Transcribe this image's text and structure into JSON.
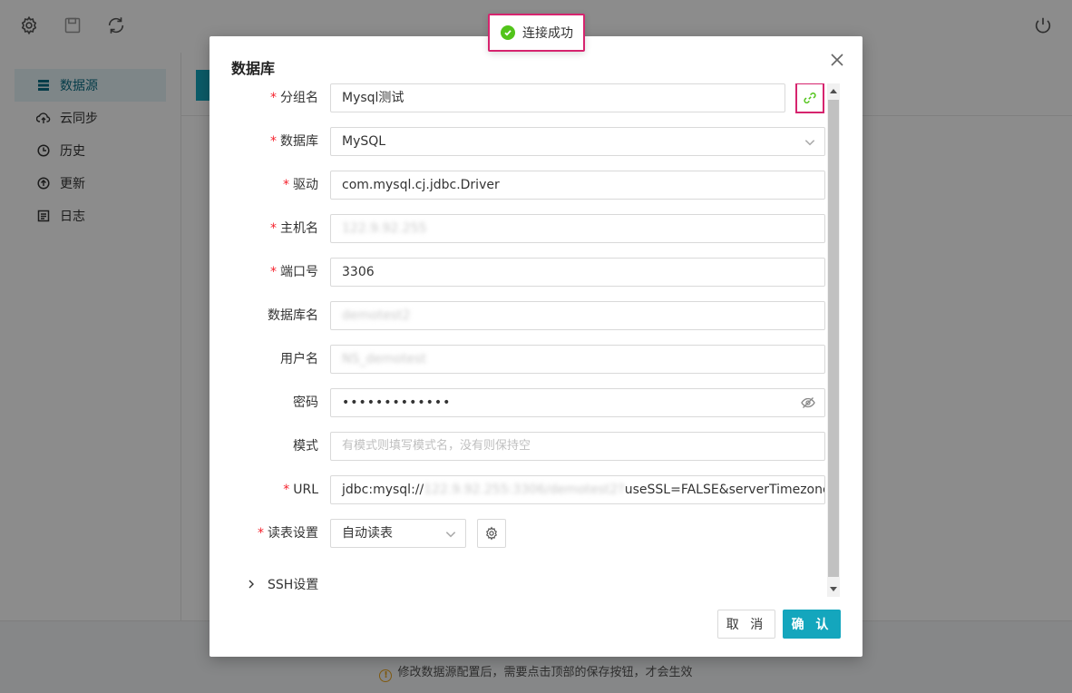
{
  "sidebar": {
    "items": [
      {
        "label": "数据源",
        "icon": "database-icon",
        "active": true
      },
      {
        "label": "云同步",
        "icon": "cloud-sync-icon"
      },
      {
        "label": "历史",
        "icon": "clock-icon"
      },
      {
        "label": "更新",
        "icon": "update-icon"
      },
      {
        "label": "日志",
        "icon": "log-icon"
      }
    ]
  },
  "footer": {
    "tip": "修改数据源配置后，需要点击顶部的保存按钮，才会生效"
  },
  "toast": {
    "message": "连接成功"
  },
  "dialog": {
    "title": "数据库",
    "fields": {
      "group_name": {
        "label": "分组名",
        "value": "Mysql测试"
      },
      "database": {
        "label": "数据库",
        "value": "MySQL"
      },
      "driver": {
        "label": "驱动",
        "value": "com.mysql.cj.jdbc.Driver"
      },
      "host": {
        "label": "主机名",
        "value": "122.9.92.255"
      },
      "port": {
        "label": "端口号",
        "value": "3306"
      },
      "db_name": {
        "label": "数据库名",
        "value": "demotest2"
      },
      "username": {
        "label": "用户名",
        "value": "NS_demotest"
      },
      "password": {
        "label": "密码",
        "value": "•••••••••••••"
      },
      "schema": {
        "label": "模式",
        "placeholder": "有模式则填写模式名，没有则保持空"
      },
      "url": {
        "label": "URL",
        "prefix": "jdbc:mysql://",
        "blurred": "122.9.92.255:3306/demotest2?",
        "suffix": "useSSL=FALSE&serverTimezone=Asia/Sha"
      },
      "read_table": {
        "label": "读表设置",
        "value": "自动读表"
      }
    },
    "ssh_label": "SSH设置",
    "cancel_label": "取 消",
    "ok_label": "确 认"
  },
  "colors": {
    "accent": "#14a6bd",
    "highlight": "#d6246e",
    "success": "#52c41a",
    "required": "#f5222d"
  }
}
